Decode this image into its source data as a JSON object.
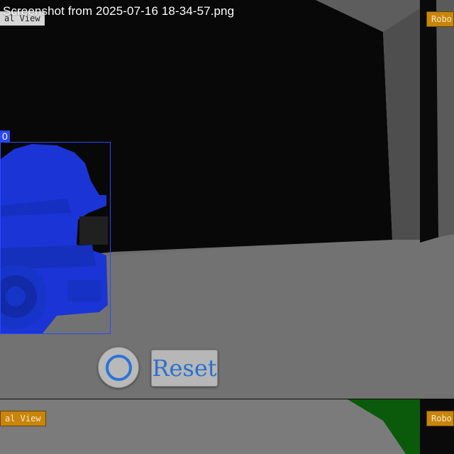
{
  "window": {
    "file_title": "Screenshot from 2025-07-16 18-34-57.png"
  },
  "top_view": {
    "left_tag": "al View",
    "right_tag": "Robo",
    "detection": {
      "label": "0",
      "color": "#2a48ff"
    }
  },
  "controls": {
    "circle_button_icon": "circle-icon",
    "reset_label": "Reset"
  },
  "bottom_view": {
    "left_tag": "al View",
    "right_tag": "Robo"
  },
  "colors": {
    "accent_blue": "#2b6fd0",
    "tag_amber": "#c8850a",
    "robot_mask": "#1a34d6",
    "floor_green": "#0b5a0b"
  }
}
